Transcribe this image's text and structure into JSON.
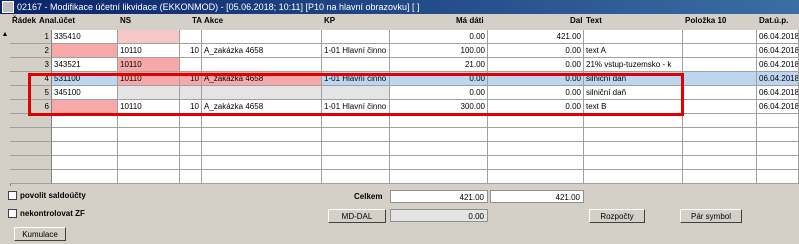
{
  "window": {
    "title": "02167 - Modifikace účetní likvidace (EKKONMOD) - [05.06.2018; 10:11]  [P10 na hlavní obrazovku]  [ ]"
  },
  "columns": {
    "radek": "Řádek",
    "anal": "Anal.účet",
    "ns": "NS",
    "ta": "TA",
    "akce": "Akce",
    "kp": "KP",
    "madati": "Má dáti",
    "dal": "Dal",
    "text": "Text",
    "polozka": "Položka 10",
    "datup": "Dat.ú.p."
  },
  "rows": [
    {
      "n": "1",
      "ucet": "335410",
      "ns": "",
      "ta": "",
      "akce": "",
      "kp": "",
      "md": "0.00",
      "dal": "421.00",
      "text": "",
      "pol": "",
      "dat": "06.04.2018"
    },
    {
      "n": "2",
      "ucet": "",
      "ns": "10110",
      "ta": "10",
      "akce": "A_zakázka 4658",
      "kp": "1-01 Hlavní činno",
      "md": "100.00",
      "dal": "0.00",
      "text": "text A",
      "pol": "",
      "dat": "06.04.2018"
    },
    {
      "n": "3",
      "ucet": "343521",
      "ns": "10110",
      "ta": "",
      "akce": "",
      "kp": "",
      "md": "21.00",
      "dal": "0.00",
      "text": "21% vstup-tuzemsko - k",
      "pol": "",
      "dat": "06.04.2018"
    },
    {
      "n": "4",
      "ucet": "531100",
      "ns": "10110",
      "ta": "10",
      "akce": "A_zakázka 4658",
      "kp": "1-01 Hlavní činno",
      "md": "0.00",
      "dal": "0.00",
      "text": "silniční daň",
      "pol": "",
      "dat": "06.04.2018"
    },
    {
      "n": "5",
      "ucet": "345100",
      "ns": "",
      "ta": "",
      "akce": "",
      "kp": "",
      "md": "0.00",
      "dal": "0.00",
      "text": "silniční daň",
      "pol": "",
      "dat": "06.04.2018"
    },
    {
      "n": "6",
      "ucet": "",
      "ns": "10110",
      "ta": "10",
      "akce": "A_zakázka 4658",
      "kp": "1-01 Hlavní činno",
      "md": "300.00",
      "dal": "0.00",
      "text": "text B",
      "pol": "",
      "dat": "06.04.2018"
    }
  ],
  "footer": {
    "povolit": "povolit saldoúčty",
    "nekontrolovat": "nekontrolovat ZF",
    "celkem_label": "Celkem",
    "celkem_md": "421.00",
    "celkem_dal": "421.00",
    "mddal_button": "MD-DAL",
    "mddal_value": "0.00",
    "rozpocty_button": "Rozpočty",
    "parsymbol_button": "Pár symbol",
    "kumulace_button": "Kumulace"
  }
}
